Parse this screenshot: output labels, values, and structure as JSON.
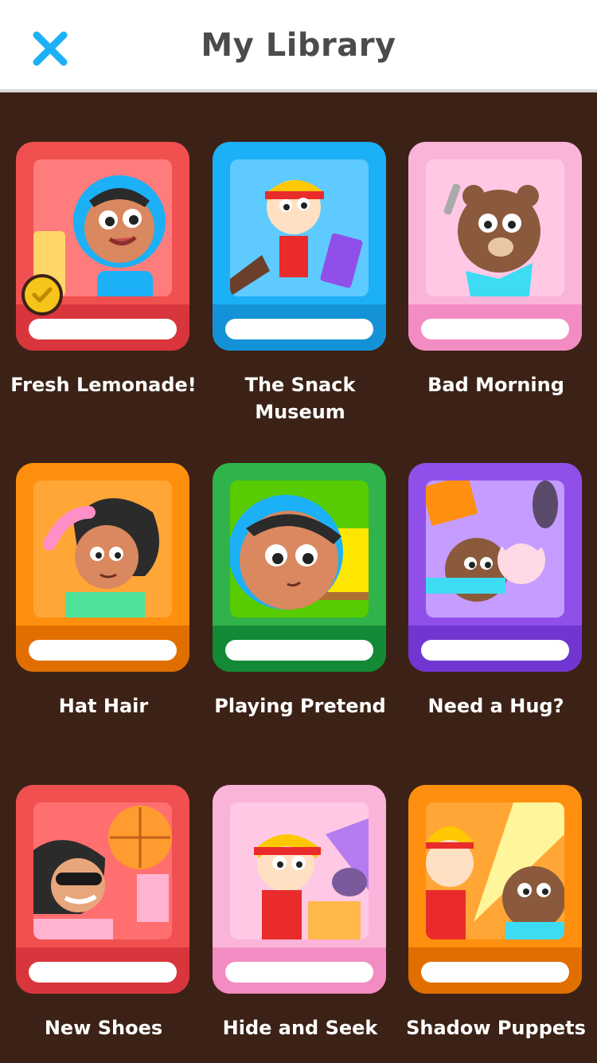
{
  "header": {
    "title": "My Library",
    "close_icon": "close-icon",
    "close_color": "#1cb0f6"
  },
  "books": [
    {
      "title": "Fresh Lemonade!",
      "cover": "#f0504f",
      "spine": "#d8363c",
      "art": "#ff7c7c",
      "completed": true,
      "check_color": "#f6c41a"
    },
    {
      "title": "The Snack Museum",
      "cover": "#1cb0f6",
      "spine": "#1492d8",
      "art": "#5fcaff",
      "completed": false
    },
    {
      "title": "Bad Morning",
      "cover": "#fab3d9",
      "spine": "#f38cc3",
      "art": "#ffc9e6",
      "completed": false
    },
    {
      "title": "Hat Hair",
      "cover": "#ff8f0f",
      "spine": "#e06f00",
      "art": "#ffa637",
      "completed": false
    },
    {
      "title": "Playing Pretend",
      "cover": "#2fb34a",
      "spine": "#138a35",
      "art": "#58cc02",
      "completed": false
    },
    {
      "title": "Need a Hug?",
      "cover": "#8f4fe8",
      "spine": "#7136d1",
      "art": "#c59cff",
      "completed": false
    },
    {
      "title": "New Shoes",
      "cover": "#f0504f",
      "spine": "#d8363c",
      "art": "#ff6f6f",
      "completed": false
    },
    {
      "title": "Hide and Seek",
      "cover": "#fab3d9",
      "spine": "#f38cc3",
      "art": "#ffc9e6",
      "completed": false
    },
    {
      "title": "Shadow Puppets",
      "cover": "#ff8f0f",
      "spine": "#e06f00",
      "art": "#ffa637",
      "completed": false
    }
  ]
}
